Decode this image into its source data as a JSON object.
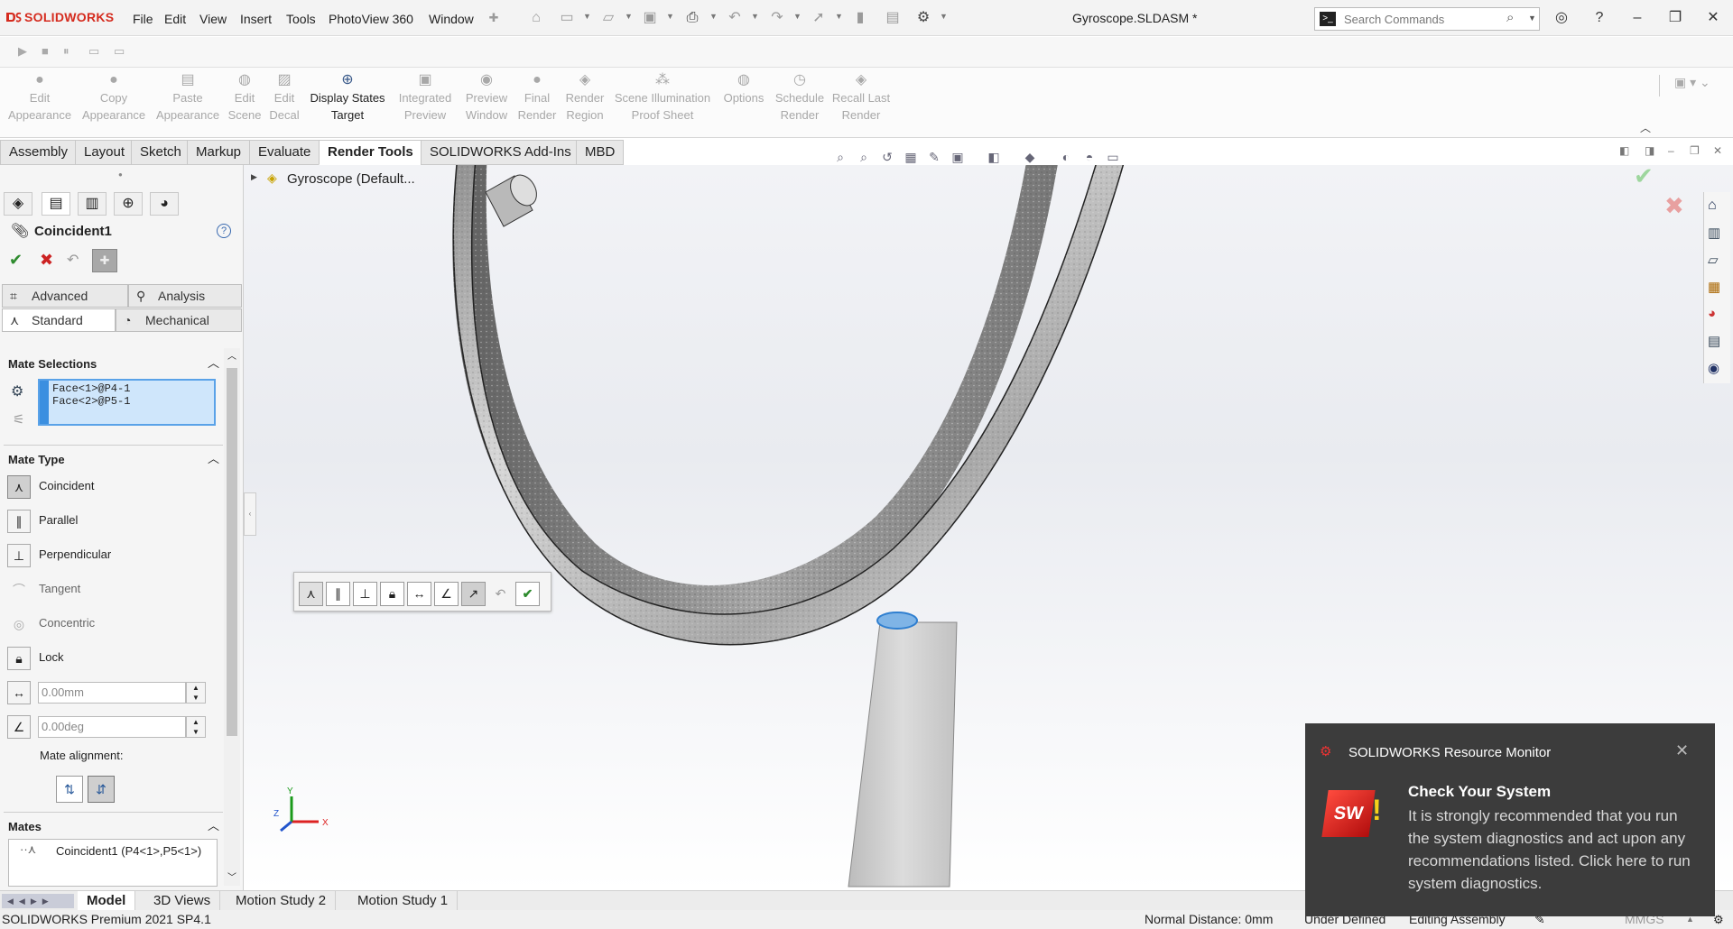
{
  "app": {
    "logo": "SOLIDWORKS",
    "doc_title": "Gyroscope.SLDASM *"
  },
  "menu": [
    "File",
    "Edit",
    "View",
    "Insert",
    "Tools",
    "PhotoView 360",
    "Window"
  ],
  "search": {
    "placeholder": "Search Commands"
  },
  "ribbon": [
    {
      "label": "Edit\nAppearance",
      "icon": "edit-appearance-icon",
      "enabled": false
    },
    {
      "label": "Copy\nAppearance",
      "icon": "copy-appearance-icon",
      "enabled": false
    },
    {
      "label": "Paste\nAppearance",
      "icon": "paste-appearance-icon",
      "enabled": false
    },
    {
      "label": "Edit\nScene",
      "icon": "edit-scene-icon",
      "enabled": false
    },
    {
      "label": "Edit\nDecal",
      "icon": "edit-decal-icon",
      "enabled": false
    },
    {
      "label": "Display States\nTarget",
      "icon": "display-states-target-icon",
      "enabled": true
    },
    {
      "label": "Integrated\nPreview",
      "icon": "integrated-preview-icon",
      "enabled": false
    },
    {
      "label": "Preview\nWindow",
      "icon": "preview-window-icon",
      "enabled": false
    },
    {
      "label": "Final\nRender",
      "icon": "final-render-icon",
      "enabled": false
    },
    {
      "label": "Render\nRegion",
      "icon": "render-region-icon",
      "enabled": false
    },
    {
      "label": "Scene Illumination\nProof Sheet",
      "icon": "proof-sheet-icon",
      "enabled": false
    },
    {
      "label": "Options",
      "icon": "options-icon",
      "enabled": false
    },
    {
      "label": "Schedule\nRender",
      "icon": "schedule-render-icon",
      "enabled": false
    },
    {
      "label": "Recall Last\nRender",
      "icon": "recall-render-icon",
      "enabled": false
    }
  ],
  "tabs": [
    "Assembly",
    "Layout",
    "Sketch",
    "Markup",
    "Evaluate",
    "Render Tools",
    "SOLIDWORKS Add-Ins",
    "MBD"
  ],
  "active_tab": "Render Tools",
  "tree": {
    "root": "Gyroscope  (Default..."
  },
  "property_manager": {
    "title": "Coincident1",
    "tabs": {
      "advanced": "Advanced",
      "analysis": "Analysis",
      "standard": "Standard",
      "mechanical": "Mechanical"
    },
    "mate_selections_header": "Mate Selections",
    "selections": [
      "Face<1>@P4-1",
      "Face<2>@P5-1"
    ],
    "mate_type_header": "Mate Type",
    "mate_types": [
      {
        "label": "Coincident",
        "icon": "coincident-icon",
        "selected": true
      },
      {
        "label": "Parallel",
        "icon": "parallel-icon",
        "selected": false
      },
      {
        "label": "Perpendicular",
        "icon": "perpendicular-icon",
        "selected": false
      },
      {
        "label": "Tangent",
        "icon": "tangent-icon",
        "selected": false,
        "disabled": true
      },
      {
        "label": "Concentric",
        "icon": "concentric-icon",
        "selected": false,
        "disabled": true
      },
      {
        "label": "Lock",
        "icon": "lock-icon",
        "selected": false
      }
    ],
    "distance_value": "0.00mm",
    "angle_value": "0.00deg",
    "mate_alignment_label": "Mate alignment:",
    "mates_header": "Mates",
    "mates_list": [
      "Coincident1 (P4<1>,P5<1>)"
    ]
  },
  "bottom_tabs": [
    "Model",
    "3D Views",
    "Motion Study 2",
    "Motion Study 1"
  ],
  "active_bottom_tab": "Model",
  "status": {
    "product": "SOLIDWORKS Premium 2021 SP4.1",
    "normal_distance": "Normal Distance: 0mm",
    "definition": "Under Defined",
    "mode": "Editing Assembly",
    "units": "MMGS"
  },
  "notification": {
    "title": "SOLIDWORKS Resource Monitor",
    "heading": "Check Your System",
    "body": "It is strongly recommended that you run the system diagnostics and act upon any recommendations listed. Click here to run system diagnostics."
  },
  "colors": {
    "accent": "#d52b1e",
    "selection_fill": "#cfe6fb",
    "selection_border": "#5aa2e8",
    "ok_green": "#2e8b2e",
    "cancel_red": "#cc2222"
  }
}
